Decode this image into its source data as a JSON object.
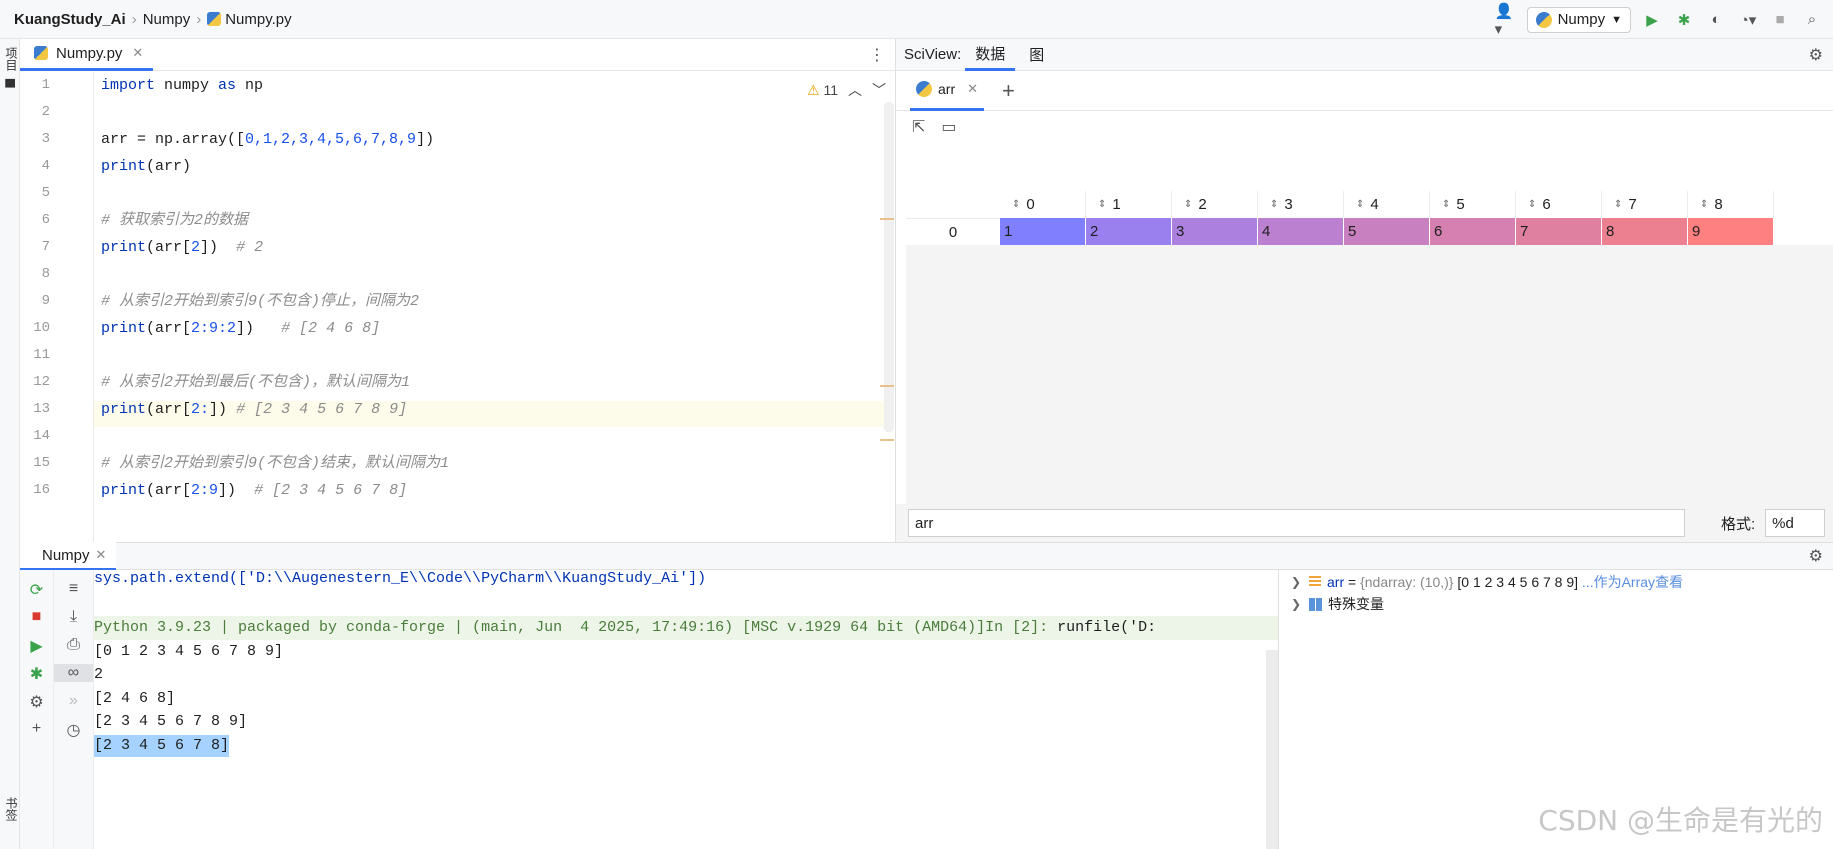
{
  "breadcrumbs": [
    "KuangStudy_Ai",
    "Numpy",
    "Numpy.py"
  ],
  "run_config": "Numpy",
  "left_strip": {
    "project_label": "项目",
    "bookmarks_label": "书签"
  },
  "editor": {
    "tab": "Numpy.py",
    "warning_count": "11",
    "line_numbers": [
      "1",
      "2",
      "3",
      "4",
      "5",
      "6",
      "7",
      "8",
      "9",
      "10",
      "11",
      "12",
      "13",
      "14",
      "15",
      "16"
    ],
    "lines": [
      {
        "kw": "import",
        "mid": " numpy ",
        "kw2": "as",
        "rest": " np"
      },
      {
        "text": ""
      },
      {
        "pre": "arr = np.array([",
        "nums": "0,1,2,3,4,5,6,7,8,9",
        "post": "])"
      },
      {
        "kw": "print",
        "rest": "(arr)"
      },
      {
        "text": ""
      },
      {
        "comment": "# 获取索引为2的数据"
      },
      {
        "kw": "print",
        "pre": "(arr[",
        "num": "2",
        "post": "])  ",
        "comment": "# 2"
      },
      {
        "text": ""
      },
      {
        "comment": "# 从索引2开始到索引9(不包含)停止，间隔为2"
      },
      {
        "kw": "print",
        "pre": "(arr[",
        "num": "2:9:2",
        "post": "])   ",
        "comment": "# [2 4 6 8]"
      },
      {
        "text": ""
      },
      {
        "comment": "# 从索引2开始到最后(不包含)，默认间隔为1"
      },
      {
        "kw": "print",
        "pre": "(arr[",
        "num": "2:",
        "post": "]) ",
        "comment": "# [2 3 4 5 6 7 8 9]"
      },
      {
        "text": ""
      },
      {
        "comment": "# 从索引2开始到索引9(不包含)结束，默认间隔为1"
      },
      {
        "kw": "print",
        "pre": "(arr[",
        "num": "2:9",
        "post": "])  ",
        "comment": "# [2 3 4 5 6 7 8]"
      }
    ]
  },
  "sciview": {
    "title": "SciView:",
    "tabs": [
      "数据",
      "图"
    ],
    "array_tab": "arr",
    "columns": [
      "0",
      "1",
      "2",
      "3",
      "4",
      "5",
      "6",
      "7",
      "8"
    ],
    "row_index": "0",
    "cells": [
      "1",
      "2",
      "3",
      "4",
      "5",
      "6",
      "7",
      "8",
      "9"
    ],
    "cell_colors": [
      "#8080ff",
      "#9a80ef",
      "#ab80df",
      "#bb80cf",
      "#c880c0",
      "#d580b0",
      "#e080a0",
      "#ec8090",
      "#ff8080"
    ],
    "expression": "arr",
    "format_label": "格式:",
    "format_value": "%d"
  },
  "console": {
    "tab": "Numpy",
    "lines": [
      "sys.path.extend(['D:\\\\Augenestern_E\\\\Code\\\\PyCharm\\\\KuangStudy_Ai'])",
      "",
      "Python 3.9.23 | packaged by conda-forge | (main, Jun  4 2025, 17:49:16) [MSC v.1929 64 bit (AMD64)]",
      "[0 1 2 3 4 5 6 7 8 9]",
      "2",
      "[2 4 6 8]",
      "[2 3 4 5 6 7 8 9]",
      "[2 3 4 5 6 7 8]"
    ],
    "prompt_in": "In [2]: ",
    "prompt_cmd": "runfile('D:"
  },
  "variables": {
    "arr_name": "arr",
    "arr_eq": " = ",
    "arr_type": "{ndarray: (10,)}",
    "arr_value": " [0 1 2 3 4 5 6 7 8 9]",
    "arr_link": "...作为Array查看",
    "special": "特殊变量"
  },
  "watermark": "CSDN @生命是有光的"
}
